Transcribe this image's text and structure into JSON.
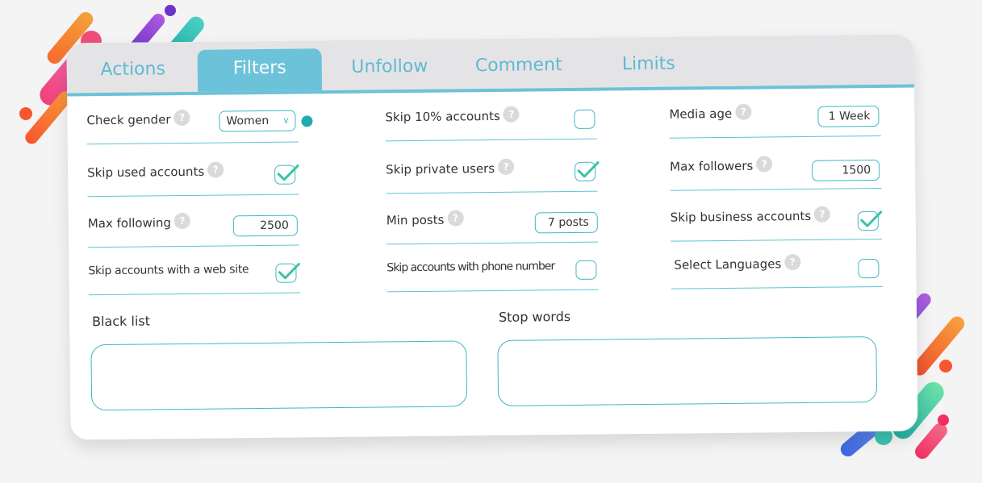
{
  "tabs": [
    {
      "label": "Actions",
      "active": false
    },
    {
      "label": "Filters",
      "active": true
    },
    {
      "label": "Unfollow",
      "active": false
    },
    {
      "label": "Comment",
      "active": false
    },
    {
      "label": "Limits",
      "active": false
    }
  ],
  "help_icon": "?",
  "filters": {
    "check_gender": {
      "label": "Check gender",
      "value": "Women",
      "chevron": "∨"
    },
    "skip_used_accounts": {
      "label": "Skip used accounts",
      "checked": true
    },
    "max_following": {
      "label": "Max following",
      "value": "2500"
    },
    "skip_web_site": {
      "label": "Skip accounts with a web site",
      "checked": true
    },
    "skip_10_percent": {
      "label": "Skip 10% accounts",
      "checked": false
    },
    "skip_private": {
      "label": "Skip private users",
      "checked": true
    },
    "min_posts": {
      "label": "Min posts",
      "value": "7 posts"
    },
    "skip_phone": {
      "label": "Skip accounts with phone number",
      "checked": false
    },
    "media_age": {
      "label": "Media age",
      "value": "1 Week"
    },
    "max_followers": {
      "label": "Max followers",
      "value": "1500"
    },
    "skip_business": {
      "label": "Skip business accounts",
      "checked": true
    },
    "select_languages": {
      "label": "Select Languages",
      "checked": false
    }
  },
  "black_list": {
    "label": "Black list",
    "value": ""
  },
  "stop_words": {
    "label": "Stop words",
    "value": ""
  },
  "colors": {
    "accent": "#6cc2d9",
    "border": "#3fb7c4",
    "check": "#3cc2a0"
  }
}
